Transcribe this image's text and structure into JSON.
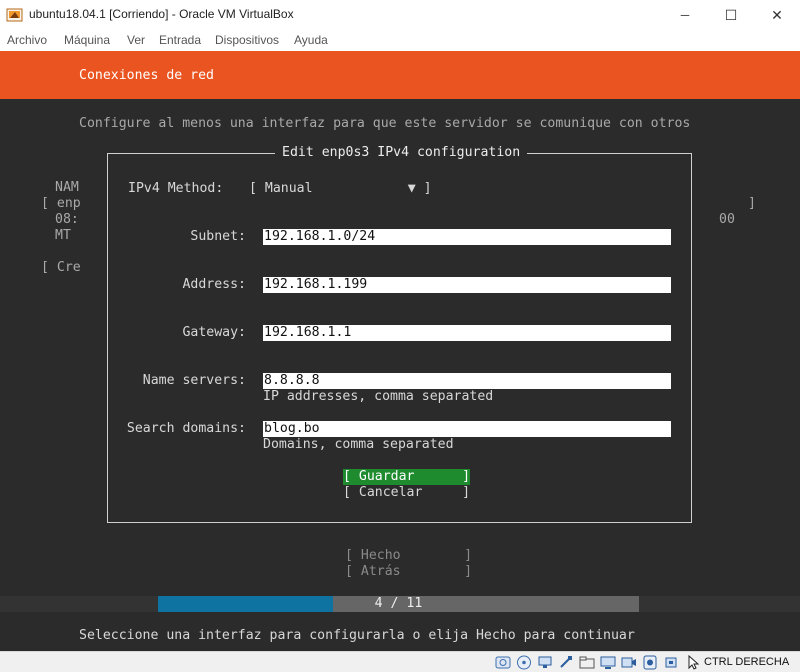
{
  "window": {
    "title": "ubuntu18.04.1 [Corriendo] - Oracle VM VirtualBox",
    "controls": {
      "minimize": "─",
      "maximize": "☐",
      "close": "✕"
    }
  },
  "menu": {
    "items": [
      "Archivo",
      "Máquina",
      "Ver",
      "Entrada",
      "Dispositivos",
      "Ayuda"
    ]
  },
  "installer": {
    "header": "Conexiones de red",
    "intro": "Configure al menos una interfaz para que este servidor se comunique con otros",
    "background": {
      "col1": [
        "NAM",
        "[ enp",
        "08:",
        "MT"
      ],
      "right_bracket": "]",
      "right_value": "00",
      "create": "[ Cre"
    },
    "dialog": {
      "title": "Edit enp0s3 IPv4 configuration",
      "method_label": "IPv4 Method:",
      "method_value": "[ Manual            ▼ ]",
      "fields": {
        "subnet_label": "Subnet:",
        "subnet_value": "192.168.1.0/24",
        "address_label": "Address:",
        "address_value": "192.168.1.199",
        "gateway_label": "Gateway:",
        "gateway_value": "192.168.1.1",
        "nameservers_label": "Name servers:",
        "nameservers_value": "8.8.8.8",
        "nameservers_hint": "IP addresses, comma separated",
        "searchdomains_label": "Search domains:",
        "searchdomains_value": "blog.bo",
        "searchdomains_hint": "Domains, comma separated"
      },
      "save": "[ Guardar      ]",
      "cancel": "[ Cancelar     ]"
    },
    "done": "[ Hecho        ]",
    "back": "[ Atrás        ]",
    "progress": {
      "text": "4 / 11",
      "current": 4,
      "total": 11
    },
    "footer": "Seleccione una interfaz para configurarla o elija Hecho para continuar"
  },
  "statusbar": {
    "host_key": "CTRL DERECHA",
    "icons": [
      "hard-disk-icon",
      "optical-drive-icon",
      "network-icon",
      "usb-icon",
      "shared-folders-icon",
      "display-icon",
      "video-capture-icon",
      "recording-icon",
      "cpu-icon",
      "mouse-integration-icon"
    ]
  },
  "colors": {
    "ubuntu_orange": "#e95420",
    "terminal_bg": "#2b2b2b",
    "button_green": "#1e8c2e",
    "progress_blue": "#0f73a1"
  }
}
